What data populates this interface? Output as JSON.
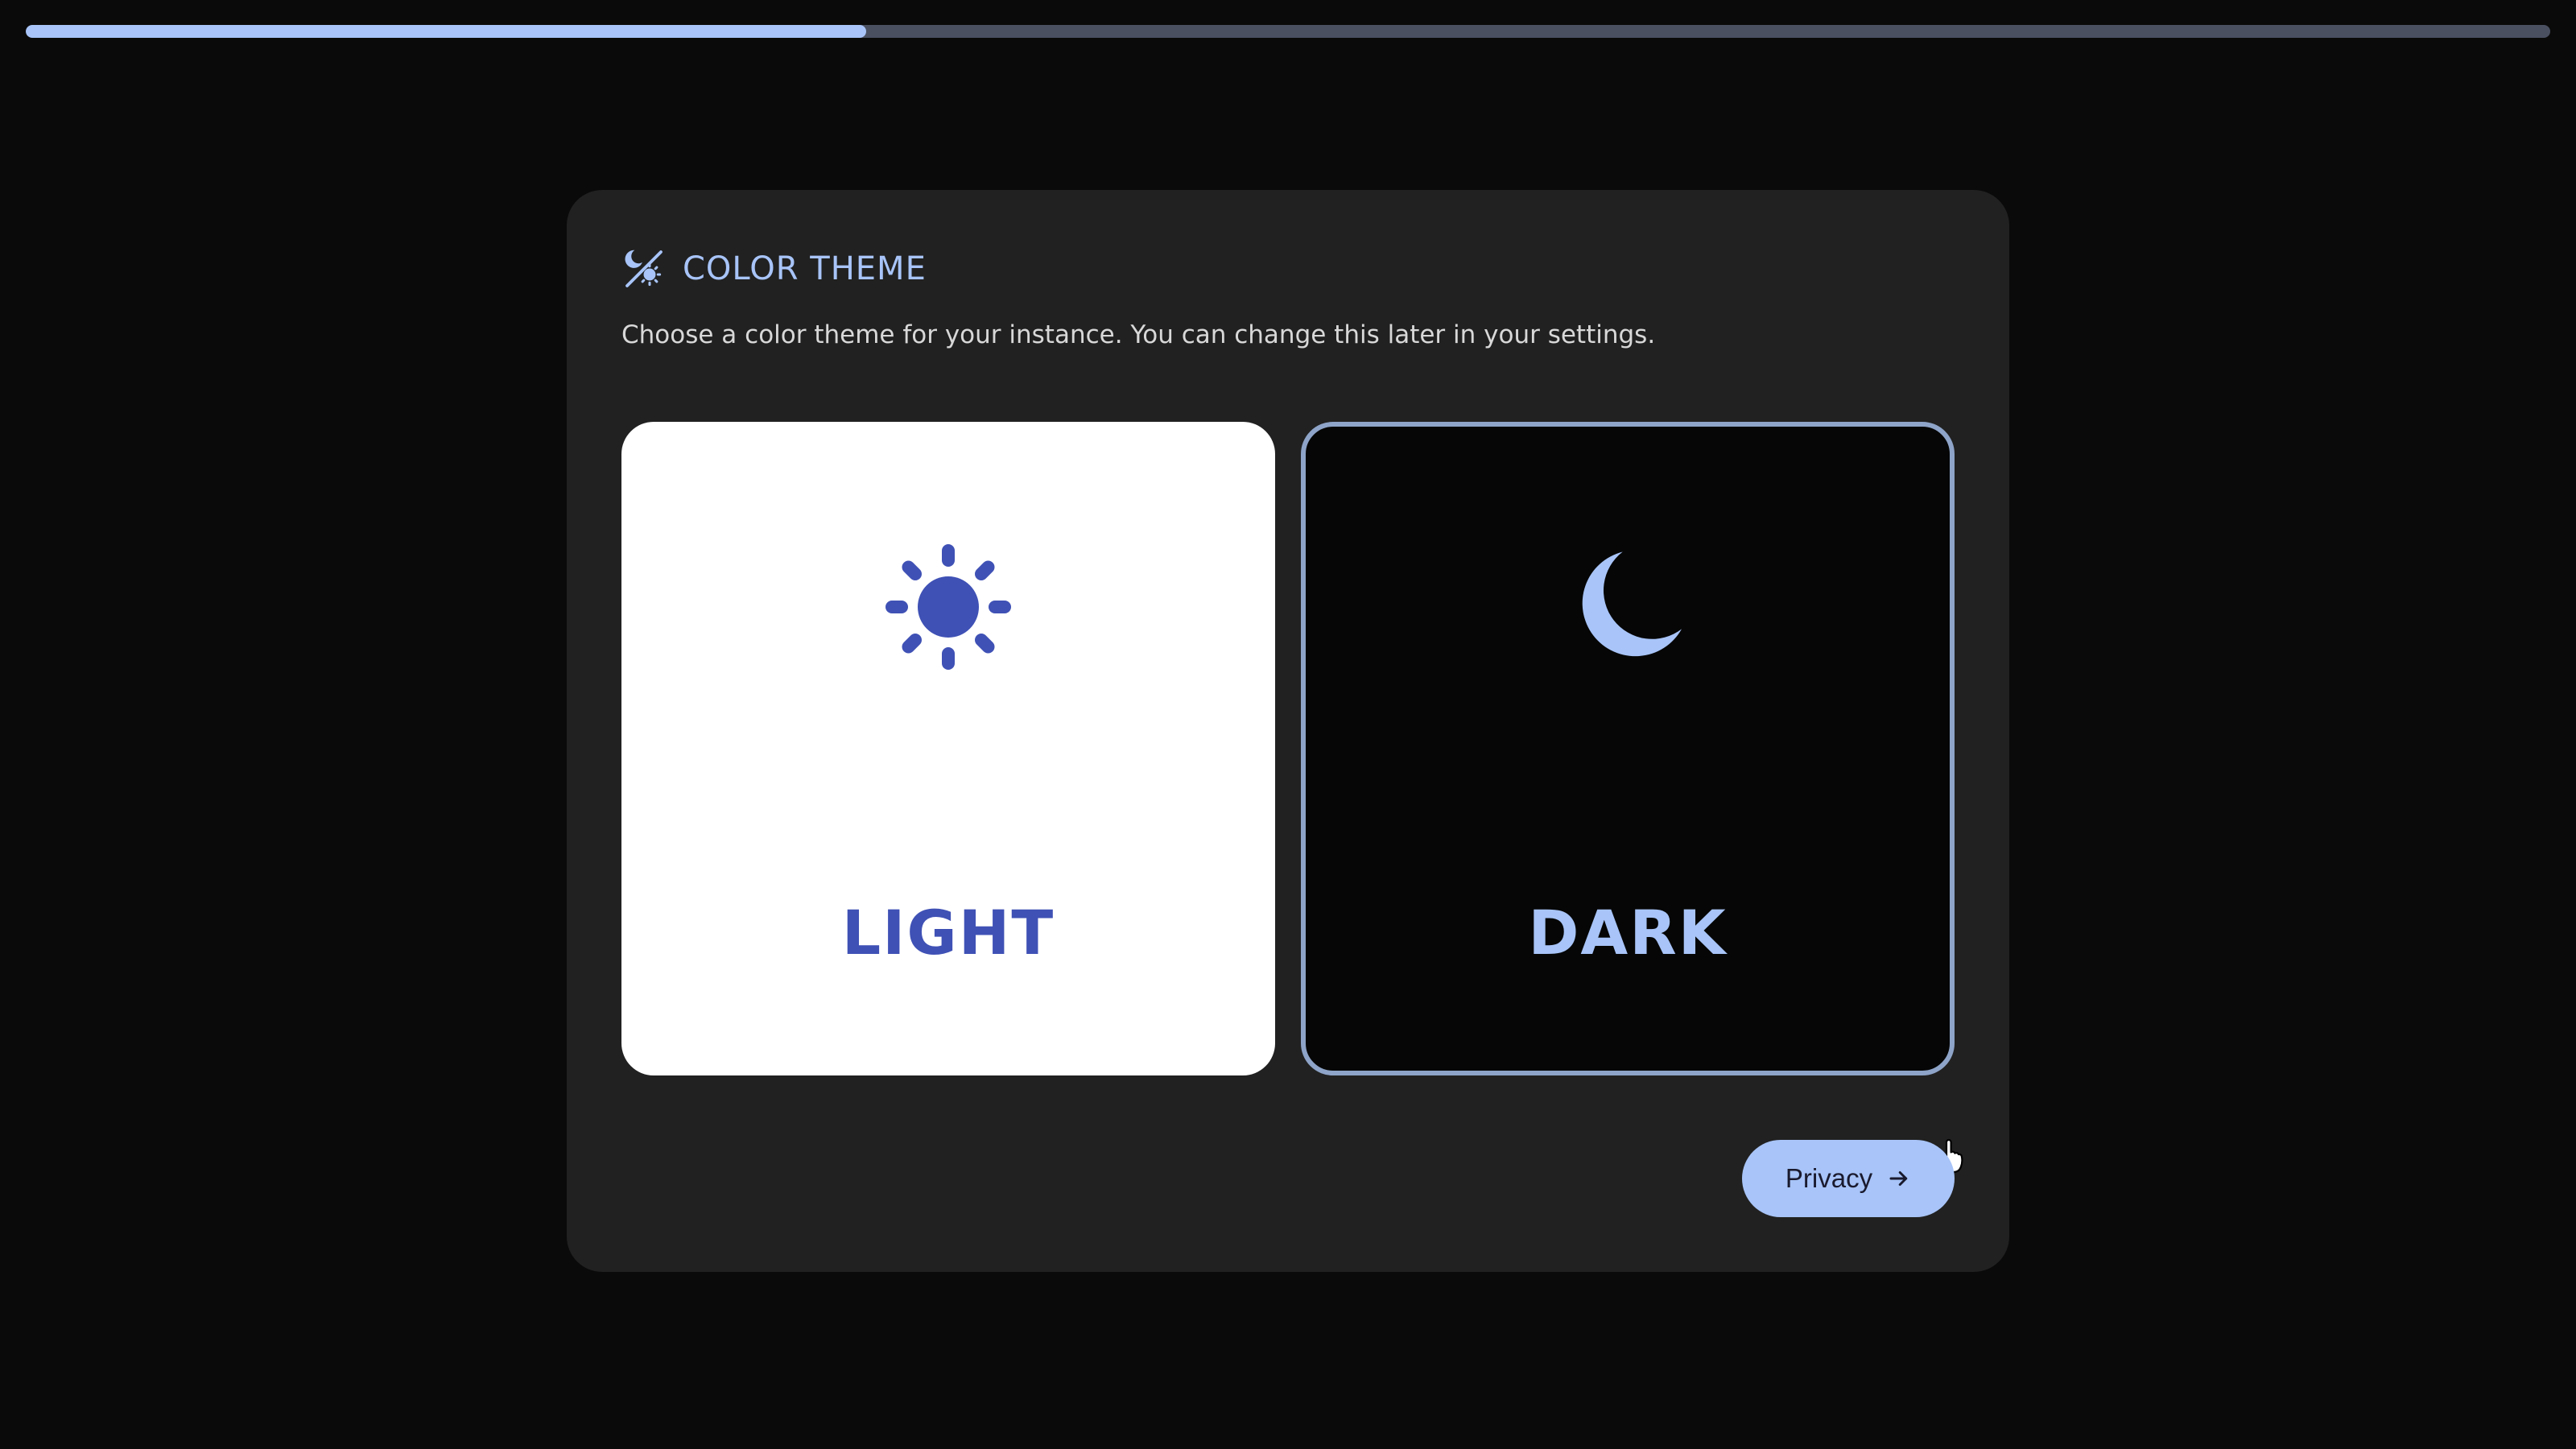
{
  "progress": {
    "value_percent": 33.3
  },
  "header": {
    "icon": "theme-palette-icon",
    "title": "COLOR THEME"
  },
  "subtitle": "Choose a color theme for your instance. You can change this later in your settings.",
  "themes": [
    {
      "id": "light",
      "label": "LIGHT",
      "icon": "sun-icon",
      "selected": false
    },
    {
      "id": "dark",
      "label": "DARK",
      "icon": "moon-icon",
      "selected": true
    }
  ],
  "next_button": {
    "label": "Privacy",
    "icon": "arrow-right-icon"
  },
  "colors": {
    "accent": "#a8c4f8",
    "light_accent": "#3f51b5",
    "card_bg": "#212121",
    "page_bg": "#0a0a0a"
  }
}
